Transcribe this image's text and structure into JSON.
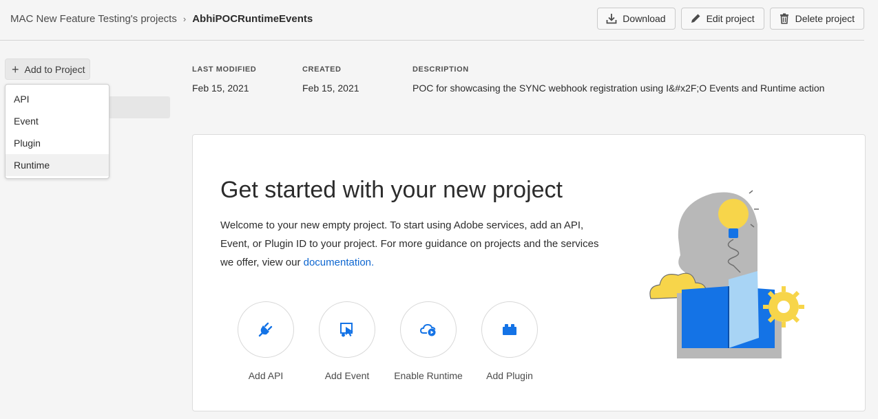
{
  "breadcrumb": {
    "parent": "MAC New Feature Testing's projects",
    "separator": "›",
    "current": "AbhiPOCRuntimeEvents"
  },
  "header_actions": {
    "download": "Download",
    "edit": "Edit project",
    "delete": "Delete project"
  },
  "add_to_project": {
    "label": "Add to Project",
    "menu": [
      "API",
      "Event",
      "Plugin",
      "Runtime"
    ]
  },
  "meta": {
    "last_modified_label": "LAST MODIFIED",
    "last_modified": "Feb 15, 2021",
    "created_label": "CREATED",
    "created": "Feb 15, 2021",
    "description_label": "DESCRIPTION",
    "description": "POC for showcasing the SYNC webhook registration using I&#x2F;O Events and Runtime action"
  },
  "card": {
    "title": "Get started with your new project",
    "text": "Welcome to your new empty project. To start using Adobe services, add an API, Event, or Plugin ID to your project. For more guidance on projects and the services we offer, view our ",
    "link": "documentation.",
    "actions": [
      {
        "label": "Add API",
        "icon": "plug-icon"
      },
      {
        "label": "Add Event",
        "icon": "event-icon"
      },
      {
        "label": "Enable Runtime",
        "icon": "cloud-runtime-icon"
      },
      {
        "label": "Add Plugin",
        "icon": "plugin-block-icon"
      }
    ]
  },
  "colors": {
    "accent": "#0d66d0",
    "icon_blue": "#1473e6",
    "illustration_yellow": "#f7d54a",
    "illustration_gray": "#b8b8b8"
  }
}
